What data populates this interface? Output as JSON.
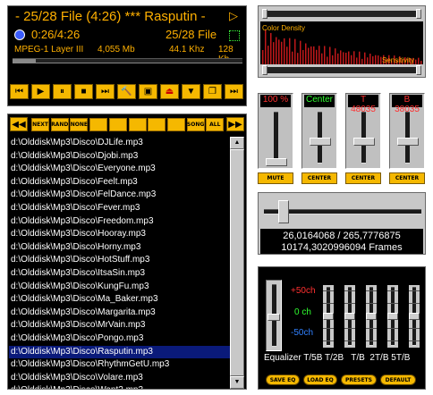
{
  "player": {
    "title": "- 25/28 File (4:26) *** Rasputin -",
    "time": "0:26/4:26",
    "track_position": "25/28 File",
    "format": "MPEG-1 Layer III",
    "file_size": "4,055 Mb",
    "sample_rate": "44.1 Khz",
    "bitrate": "128 Kb",
    "seek_fraction": 0.1,
    "colors": {
      "accent": "#f5b800",
      "text": "#ffb000",
      "selection": "#0a1a7a"
    }
  },
  "transport_icons": [
    "prev-icon",
    "play-icon",
    "pause-icon",
    "stop-icon",
    "next-icon",
    "hammer-icon",
    "screen-icon",
    "eject-icon",
    "down-icon",
    "window-icon",
    "skip-end-icon"
  ],
  "spectrum": {
    "label_left": "Color Density",
    "label_right": "Sensitivity",
    "colors": {
      "bars": "#c0181a",
      "background": "#000000"
    }
  },
  "mixer": {
    "volume_label": "100 %",
    "balance_label": "Center",
    "treble_label": "T 48035",
    "bass_label": "B 38035",
    "mute_label": "MUTE",
    "center_label_1": "CENTER",
    "center_label_2": "CENTER",
    "center_label_3": "CENTER",
    "volume_level": 0.1,
    "balance_level": 0.5,
    "treble_level": 0.5,
    "bass_level": 0.5
  },
  "position": {
    "readout": "26,0164068 / 265,7776875",
    "frames": "10174,3020996094 Frames",
    "level": 0.1
  },
  "equalizer": {
    "plus_label": "+50ch",
    "zero_label": "0 ch",
    "minus_label": "-50ch",
    "bottom_labels": "Equalizer T/5B T/2B   T/B  2T/B 5T/B",
    "save_label": "SAVE EQ",
    "load_label": "LOAD EQ",
    "presets_label": "PRESETS",
    "default_label": "DEFAULT",
    "preamp_level": 0.5,
    "bands": [
      0.5,
      0.5,
      0.5,
      0.5,
      0.5
    ]
  },
  "playlist": {
    "toolbar": [
      "NEXT",
      "RAND",
      "NONE",
      "",
      "",
      "",
      "",
      "",
      "SONG",
      "ALL"
    ],
    "items": [
      "d:\\Olddisk\\Mp3\\Disco\\DJLife.mp3",
      "d:\\Olddisk\\Mp3\\Disco\\Djobi.mp3",
      "d:\\Olddisk\\Mp3\\Disco\\Everyone.mp3",
      "d:\\Olddisk\\Mp3\\Disco\\Feelt.mp3",
      "d:\\Olddisk\\Mp3\\Disco\\FelDance.mp3",
      "d:\\Olddisk\\Mp3\\Disco\\Fever.mp3",
      "d:\\Olddisk\\Mp3\\Disco\\Freedom.mp3",
      "d:\\Olddisk\\Mp3\\Disco\\Hooray.mp3",
      "d:\\Olddisk\\Mp3\\Disco\\Horny.mp3",
      "d:\\Olddisk\\Mp3\\Disco\\HotStuff.mp3",
      "d:\\Olddisk\\Mp3\\Disco\\ItsaSin.mp3",
      "d:\\Olddisk\\Mp3\\Disco\\KungFu.mp3",
      "d:\\Olddisk\\Mp3\\Disco\\Ma_Baker.mp3",
      "d:\\Olddisk\\Mp3\\Disco\\Margarita.mp3",
      "d:\\Olddisk\\Mp3\\Disco\\MrVain.mp3",
      "d:\\Olddisk\\Mp3\\Disco\\Pongo.mp3",
      "d:\\Olddisk\\Mp3\\Disco\\Rasputin.mp3",
      "d:\\Olddisk\\Mp3\\Disco\\RhythmGetU.mp3",
      "d:\\Olddisk\\Mp3\\Disco\\Volare.mp3",
      "d:\\Olddisk\\Mp3\\Disco\\Want2.mp3"
    ],
    "selected_index": 16
  }
}
